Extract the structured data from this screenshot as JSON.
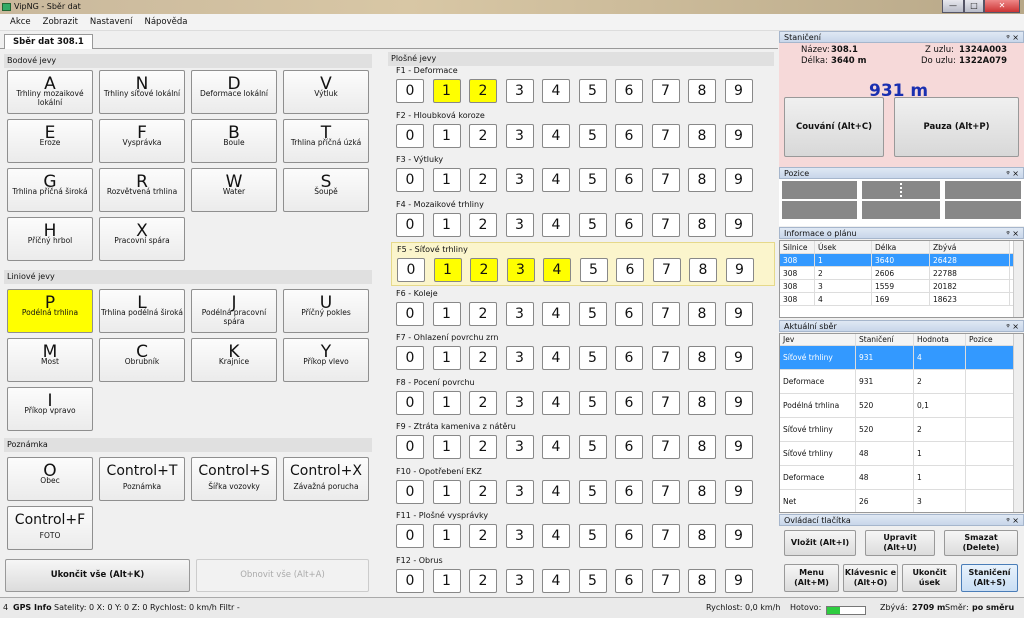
{
  "window": {
    "title": "VipNG - Sběr dat",
    "buttons": {
      "minimize": "—",
      "maximize": "□",
      "close": "✕"
    }
  },
  "menu": [
    "Akce",
    "Zobrazit",
    "Nastavení",
    "Nápověda"
  ],
  "tab": "Sběr dat 308.1",
  "bodove": {
    "title": "Bodové jevy",
    "keys": [
      {
        "k": "A",
        "l": "Trhliny mozaikové lokální",
        "hl": false
      },
      {
        "k": "N",
        "l": "Trhliny síťové lokální",
        "hl": false
      },
      {
        "k": "D",
        "l": "Deformace lokální",
        "hl": false
      },
      {
        "k": "V",
        "l": "Výtluk",
        "hl": false
      },
      {
        "k": "E",
        "l": "Eroze",
        "hl": false
      },
      {
        "k": "F",
        "l": "Vysprávka",
        "hl": false
      },
      {
        "k": "B",
        "l": "Boule",
        "hl": false
      },
      {
        "k": "T",
        "l": "Trhlina příčná úzká",
        "hl": false
      },
      {
        "k": "G",
        "l": "Trhlina příčná široká",
        "hl": false
      },
      {
        "k": "R",
        "l": "Rozvětvená trhlina",
        "hl": false
      },
      {
        "k": "W",
        "l": "Water",
        "hl": false
      },
      {
        "k": "S",
        "l": "Šoupě",
        "hl": false
      },
      {
        "k": "H",
        "l": "Příčný hrbol",
        "hl": false
      },
      {
        "k": "X",
        "l": "Pracovní spára",
        "hl": false
      }
    ]
  },
  "liniove": {
    "title": "Liniové jevy",
    "keys": [
      {
        "k": "P",
        "l": "Podélná trhlina",
        "hl": true
      },
      {
        "k": "L",
        "l": "Trhlina podélná široká",
        "hl": false
      },
      {
        "k": "J",
        "l": "Podélná pracovní spára",
        "hl": false
      },
      {
        "k": "U",
        "l": "Příčný pokles",
        "hl": false
      },
      {
        "k": "M",
        "l": "Most",
        "hl": false
      },
      {
        "k": "C",
        "l": "Obrubník",
        "hl": false
      },
      {
        "k": "K",
        "l": "Krajnice",
        "hl": false
      },
      {
        "k": "Y",
        "l": "Příkop vlevo",
        "hl": false
      },
      {
        "k": "I",
        "l": "Příkop vpravo",
        "hl": false
      }
    ]
  },
  "poznamka": {
    "title": "Poznámka",
    "keys": [
      {
        "k": "O",
        "l": "Obec",
        "hl": false
      },
      {
        "k": "Control+T",
        "l": "Poznámka",
        "hl": false
      },
      {
        "k": "Control+S",
        "l": "Šířka vozovky",
        "hl": false
      },
      {
        "k": "Control+X",
        "l": "Závažná porucha",
        "hl": false
      },
      {
        "k": "Control+F",
        "l": "FOTO",
        "hl": false
      }
    ]
  },
  "bottom": {
    "end_all": "Ukončit vše (Alt+K)",
    "restore_all": "Obnovit vše (Alt+A)"
  },
  "plosne": {
    "title": "Plošné jevy",
    "groups": [
      {
        "label": "F1 - Deformace",
        "on": [
          1,
          2
        ],
        "hl": false
      },
      {
        "label": "F2 - Hloubková koroze",
        "on": [],
        "hl": false
      },
      {
        "label": "F3 - Výtluky",
        "on": [],
        "hl": false
      },
      {
        "label": "F4 - Mozaikové trhliny",
        "on": [],
        "hl": false
      },
      {
        "label": "F5 - Síťové trhliny",
        "on": [
          1,
          2,
          3,
          4
        ],
        "hl": true
      },
      {
        "label": "F6 - Koleje",
        "on": [],
        "hl": false
      },
      {
        "label": "F7 - Ohlazení povrchu zrn",
        "on": [],
        "hl": false
      },
      {
        "label": "F8 - Pocení povrchu",
        "on": [],
        "hl": false
      },
      {
        "label": "F9 - Ztráta kameniva z nátěru",
        "on": [],
        "hl": false
      },
      {
        "label": "F10 - Opotřebení EKZ",
        "on": [],
        "hl": false
      },
      {
        "label": "F11 - Plošné vysprávky",
        "on": [],
        "hl": false
      },
      {
        "label": "F12 - Obrus",
        "on": [],
        "hl": false
      }
    ],
    "digits": [
      "0",
      "1",
      "2",
      "3",
      "4",
      "5",
      "6",
      "7",
      "8",
      "9"
    ]
  },
  "staniceni": {
    "title": "Staničení",
    "nazev_l": "Název:",
    "nazev": "308.1",
    "delka_l": "Délka:",
    "delka": "3640 m",
    "zuzlu_l": "Z uzlu:",
    "zuzlu": "1324A003",
    "douzlu_l": "Do uzlu:",
    "douzlu": "1322A079",
    "value": "931 m",
    "couvani": "Couvání (Alt+C)",
    "pauza": "Pauza (Alt+P)"
  },
  "pozice": {
    "title": "Pozice"
  },
  "plan": {
    "title": "Informace o plánu",
    "cols": [
      "Silnice",
      "Úsek",
      "Délka",
      "Zbývá"
    ],
    "rows": [
      [
        "308",
        "1",
        "3640",
        "26428"
      ],
      [
        "308",
        "2",
        "2606",
        "22788"
      ],
      [
        "308",
        "3",
        "1559",
        "20182"
      ],
      [
        "308",
        "4",
        "169",
        "18623"
      ]
    ]
  },
  "sber": {
    "title": "Aktuální sběr",
    "cols": [
      "Jev",
      "Staničení",
      "Hodnota",
      "Pozice"
    ],
    "rows": [
      [
        "Síťové trhliny",
        "931",
        "4",
        ""
      ],
      [
        "Deformace",
        "931",
        "2",
        ""
      ],
      [
        "Podélná trhlina",
        "520",
        "0,1",
        ""
      ],
      [
        "Síťové trhliny",
        "520",
        "2",
        ""
      ],
      [
        "Síťové trhliny",
        "48",
        "1",
        ""
      ],
      [
        "Deformace",
        "48",
        "1",
        ""
      ],
      [
        "Net",
        "26",
        "3",
        ""
      ]
    ]
  },
  "ovladaci": {
    "title": "Ovládací tlačítka",
    "vlozit": "Vložit (Alt+I)",
    "upravit": "Upravit (Alt+U)",
    "smazat": "Smazat (Delete)",
    "menu": "Menu (Alt+M)",
    "klavesnice": "Klávesnic e (Alt+O)",
    "ukoncit": "Ukončit úsek",
    "staniceni": "Staničení (Alt+S)"
  },
  "pin": "ᵠ ×",
  "status": {
    "num": "4",
    "gps": "GPS Info",
    "satelity": "Satelity: 0  X: 0  Y: 0  Z: 0  Rychlost: 0 km/h  Filtr  -",
    "rychlost": "Rychlost:  0,0 km/h",
    "hotovo": "Hotovo:",
    "hotovo_frac": 0.35,
    "zbyva_l": "Zbývá:",
    "zbyva": "2709 m",
    "smer_l": "Směr:",
    "smer": "po směru"
  }
}
